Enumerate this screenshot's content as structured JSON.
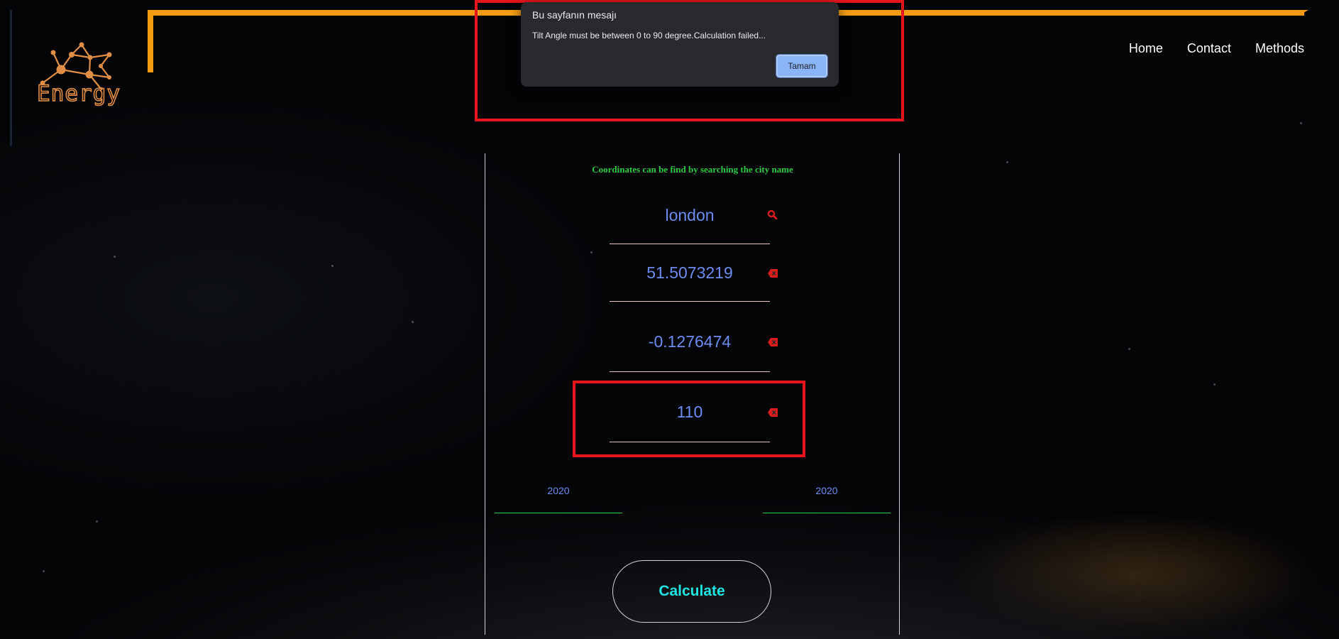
{
  "header": {
    "logo_text": "Energy",
    "nav": [
      "Home",
      "Contact",
      "Methods"
    ]
  },
  "colors": {
    "accent": "#f39c12",
    "input_text": "#6c8cf0",
    "hint": "#2ecc40",
    "button_text": "#1fe4e4",
    "highlight": "#e8141c",
    "dialog_bg": "#292a2d"
  },
  "form": {
    "hint": "Coordinates can be find by searching the city name",
    "city": {
      "value": "london",
      "icon": "search-icon"
    },
    "latitude": {
      "value": "51.5073219",
      "icon": "backspace-icon"
    },
    "longitude": {
      "value": "-0.1276474",
      "icon": "backspace-icon"
    },
    "tilt": {
      "value": "110",
      "icon": "backspace-icon"
    },
    "start_year": "2020",
    "end_year": "2020",
    "calculate_label": "Calculate"
  },
  "dialog": {
    "title": "Bu sayfanın mesajı",
    "message": "Tilt Angle must be between 0 to 90 degree.Calculation failed...",
    "ok_label": "Tamam"
  }
}
